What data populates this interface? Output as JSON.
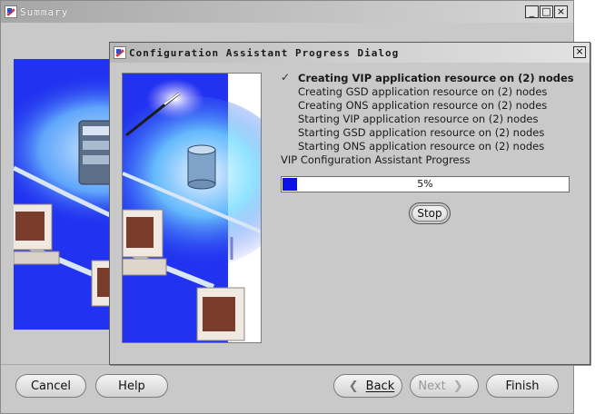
{
  "summary_window": {
    "title": "Summary",
    "controls": {
      "minimize": "_",
      "maximize": "□",
      "close": "×"
    },
    "buttons": {
      "cancel": "Cancel",
      "help": "Help",
      "back": "Back",
      "next": "Next",
      "finish": "Finish"
    }
  },
  "progress_dialog": {
    "title": "Configuration Assistant Progress Dialog",
    "close": "×",
    "steps": [
      "Creating VIP application resource on (2) nodes",
      "Creating GSD application resource on (2) nodes",
      "Creating ONS application resource on (2) nodes",
      "Starting VIP application resource on (2) nodes",
      "Starting GSD application resource on (2) nodes",
      "Starting ONS application resource on (2) nodes"
    ],
    "current_step_index": 0,
    "assistant_label": "VIP Configuration Assistant Progress",
    "progress": {
      "value": 5,
      "text": "5%"
    },
    "stop_label": "Stop"
  },
  "colors": {
    "window_bg": "#c9c9c9",
    "art_blue": "#2132f0",
    "progress_fill": "#0a10e6"
  },
  "icons": [
    "app-icon",
    "minimize-icon",
    "maximize-icon",
    "close-icon",
    "checkmark-icon",
    "back-arrow-icon",
    "next-arrow-icon"
  ]
}
